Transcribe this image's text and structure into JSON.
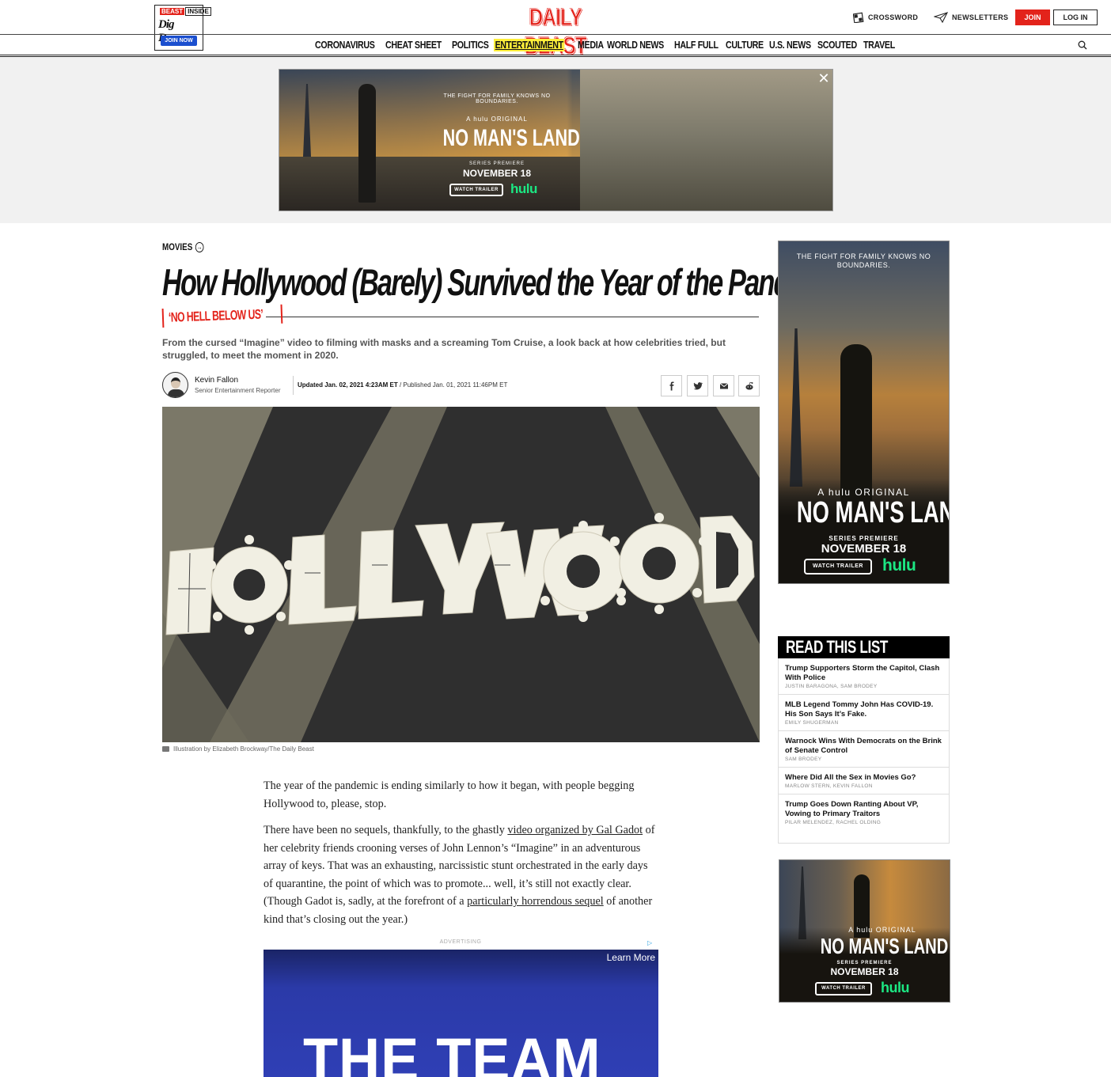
{
  "header": {
    "beast_inside": {
      "badge_left": "BEAST",
      "badge_right": "INSIDE",
      "tagline": "Dig Deeper",
      "cta": "JOIN NOW"
    },
    "logo": "DAILY BEAST",
    "crossword": "CROSSWORD",
    "newsletters": "NEWSLETTERS",
    "join": "JOIN",
    "login": "LOG IN",
    "nav": [
      "CORONAVIRUS",
      "CHEAT SHEET",
      "POLITICS",
      "ENTERTAINMENT",
      "MEDIA",
      "WORLD NEWS",
      "HALF FULL",
      "CULTURE",
      "U.S. NEWS",
      "SCOUTED",
      "TRAVEL"
    ],
    "active_nav": "ENTERTAINMENT"
  },
  "top_ad": {
    "tagline": "THE FIGHT FOR FAMILY KNOWS NO BOUNDARIES.",
    "hulu_original": "A hulu ORIGINAL",
    "title": "NO MAN'S LAND",
    "premiere": "SERIES PREMIERE",
    "date": "NOVEMBER 18",
    "watch": "WATCH TRAILER",
    "brand": "hulu",
    "close": "✕"
  },
  "article": {
    "section": "MOVIES",
    "headline": "How Hollywood (Barely) Survived the Year of the Pandemic",
    "rubric": "‘NO HELL BELOW US’",
    "dek": "From the cursed “Imagine” video to filming with masks and a screaming Tom Cruise, a look back at how celebrities tried, but struggled, to meet the moment in 2020.",
    "author": {
      "name": "Kevin Fallon",
      "title": "Senior Entertainment Reporter"
    },
    "updated": "Updated Jan. 02, 2021 4:23AM ET",
    "published": " / Published Jan. 01, 2021 11:46PM ET",
    "hero_alt_text": "HOLLYWOOD",
    "caption": "Illustration by Elizabeth Brockway/The Daily Beast",
    "paragraphs": {
      "p1": "The year of the pandemic is ending similarly to how it began, with people begging Hollywood to, please, stop.",
      "p2_a": "There have been no sequels, thankfully, to the ghastly ",
      "p2_link1": "video organized by Gal Gadot",
      "p2_b": " of her celebrity friends crooning verses of John Lennon’s “Imagine” in an adventurous array of keys. That was an exhausting, narcissistic stunt orchestrated in the early days of quarantine, the point of which was to promote... well, it’s still not exactly clear. (Though Gadot is, sadly, at the forefront of a ",
      "p2_link2": "particularly horrendous sequel",
      "p2_c": " of another kind that’s closing out the year.)"
    },
    "advertising_label": "ADVERTISING",
    "inline_ad": {
      "learn_more": "Learn More",
      "headline": "THE TEAM"
    }
  },
  "sidebar": {
    "ad1": {
      "tagline": "THE FIGHT FOR FAMILY KNOWS NO BOUNDARIES.",
      "hulu_original": "A hulu ORIGINAL",
      "title": "NO MAN'S LAND",
      "premiere": "SERIES PREMIERE",
      "date": "NOVEMBER 18",
      "watch": "WATCH TRAILER",
      "brand": "hulu"
    },
    "read_this_list": {
      "heading": "READ THIS LIST",
      "items": [
        {
          "title": "Trump Supporters Storm the Capitol, Clash With Police",
          "authors": "JUSTIN BARAGONA, SAM BRODEY"
        },
        {
          "title": "MLB Legend Tommy John Has COVID-19. His Son Says It’s Fake.",
          "authors": "EMILY SHUGERMAN"
        },
        {
          "title": "Warnock Wins With Democrats on the Brink of Senate Control",
          "authors": "SAM BRODEY"
        },
        {
          "title": "Where Did All the Sex in Movies Go?",
          "authors": "MARLOW STERN, KEVIN FALLON"
        },
        {
          "title": "Trump Goes Down Ranting About VP, Vowing to Primary Traitors",
          "authors": "PILAR MELENDEZ, RACHEL OLDING"
        }
      ]
    },
    "ad2": {
      "hulu_original": "A hulu ORIGINAL",
      "title": "NO MAN'S LAND",
      "premiere": "SERIES PREMIERE",
      "date": "NOVEMBER 18",
      "watch": "WATCH TRAILER",
      "brand": "hulu"
    }
  },
  "colors": {
    "brand_red": "#e3231b",
    "nav_highlight": "#ffef3a",
    "hulu_green": "#1ce783",
    "join_now_blue": "#1b4fcf"
  }
}
